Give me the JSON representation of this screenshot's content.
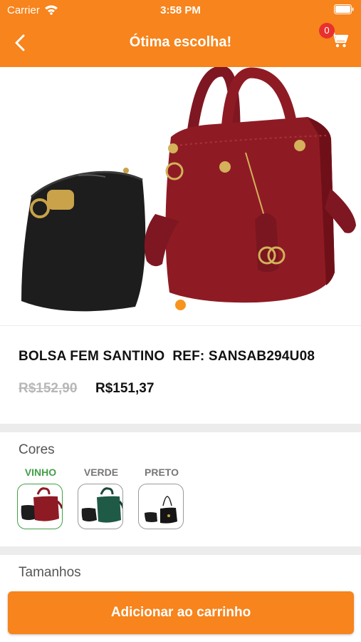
{
  "status_bar": {
    "carrier": "Carrier",
    "time": "3:58 PM"
  },
  "nav": {
    "title": "Ótima escolha!",
    "back_icon": "chevron-left-icon",
    "cart_icon": "shopping-cart-icon",
    "cart_count": "0"
  },
  "gallery": {
    "image_count": 1,
    "active_index": 0
  },
  "product": {
    "name": "BOLSA FEM SANTINO  REF: SANSAB294U08",
    "old_price": "R$152,90",
    "price": "R$151,37"
  },
  "colors": {
    "title": "Cores",
    "options": [
      {
        "label": "VINHO",
        "selected": true
      },
      {
        "label": "VERDE",
        "selected": false
      },
      {
        "label": "PRETO",
        "selected": false
      }
    ]
  },
  "sizes": {
    "title": "Tamanhos"
  },
  "actions": {
    "add_to_cart_label": "Adicionar ao carrinho"
  },
  "theme": {
    "primary": "#f7841c",
    "selected": "#43a047",
    "badge": "#e8312f",
    "wine": "#8e1b24"
  }
}
